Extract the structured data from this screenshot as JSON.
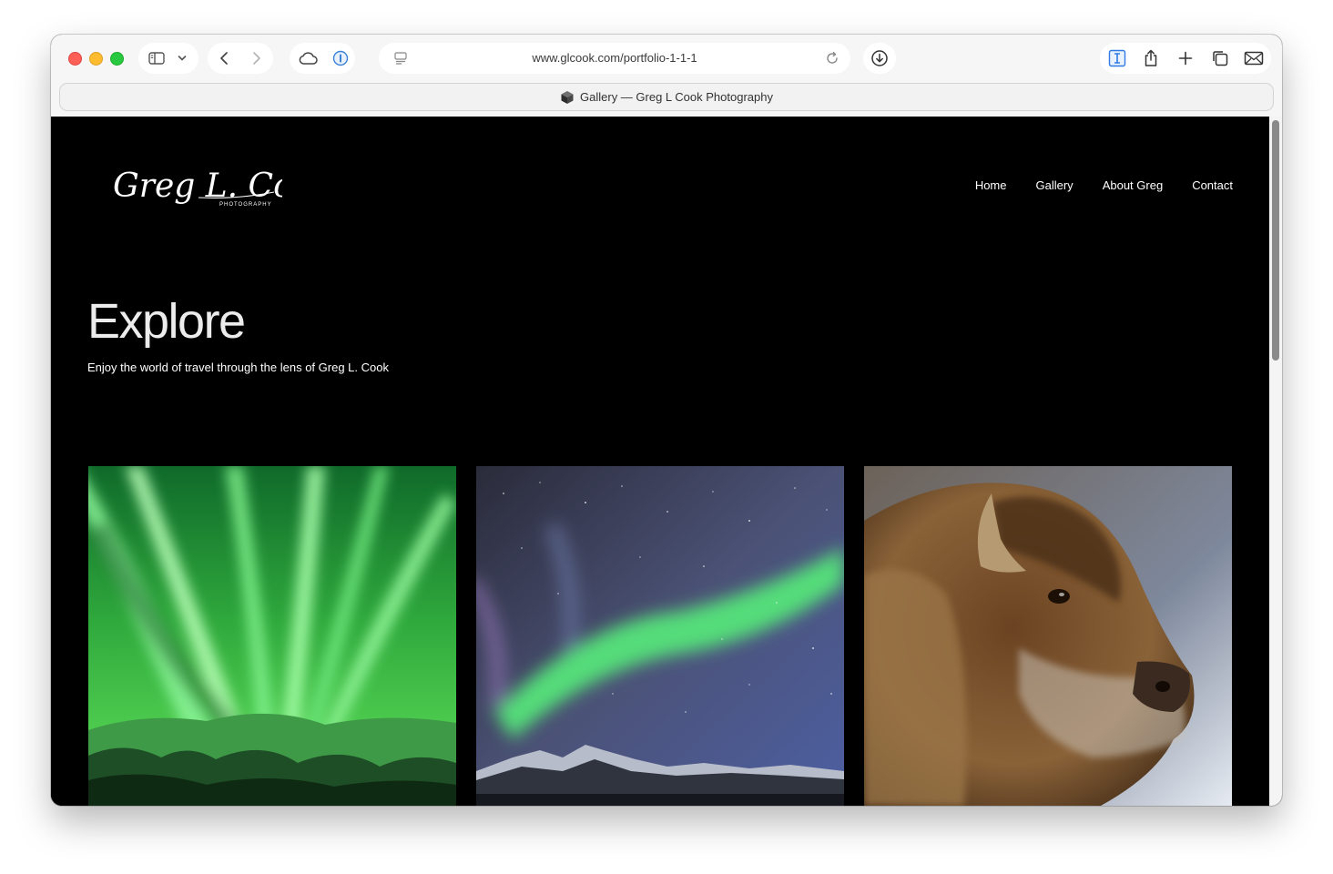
{
  "browser": {
    "url": "www.glcook.com/portfolio-1-1-1",
    "tab_title": "Gallery — Greg L Cook Photography"
  },
  "site": {
    "logo_text": "Greg L. Cook",
    "logo_subtext": "PHOTOGRAPHY",
    "nav": [
      {
        "label": "Home"
      },
      {
        "label": "Gallery"
      },
      {
        "label": "About Greg"
      },
      {
        "label": "Contact"
      }
    ],
    "hero": {
      "title": "Explore",
      "subtitle": "Enjoy the world of travel through the lens of Greg L. Cook"
    },
    "gallery": [
      {
        "subject": "green aurora over snowy hills"
      },
      {
        "subject": "aurora over mountain range"
      },
      {
        "subject": "bison close-up"
      }
    ]
  },
  "colors": {
    "page_background": "#000000",
    "nav_text": "#ffffff",
    "title_text": "#ececec",
    "close": "#fe5f57",
    "minimize": "#febc2e",
    "zoom": "#28c840"
  }
}
